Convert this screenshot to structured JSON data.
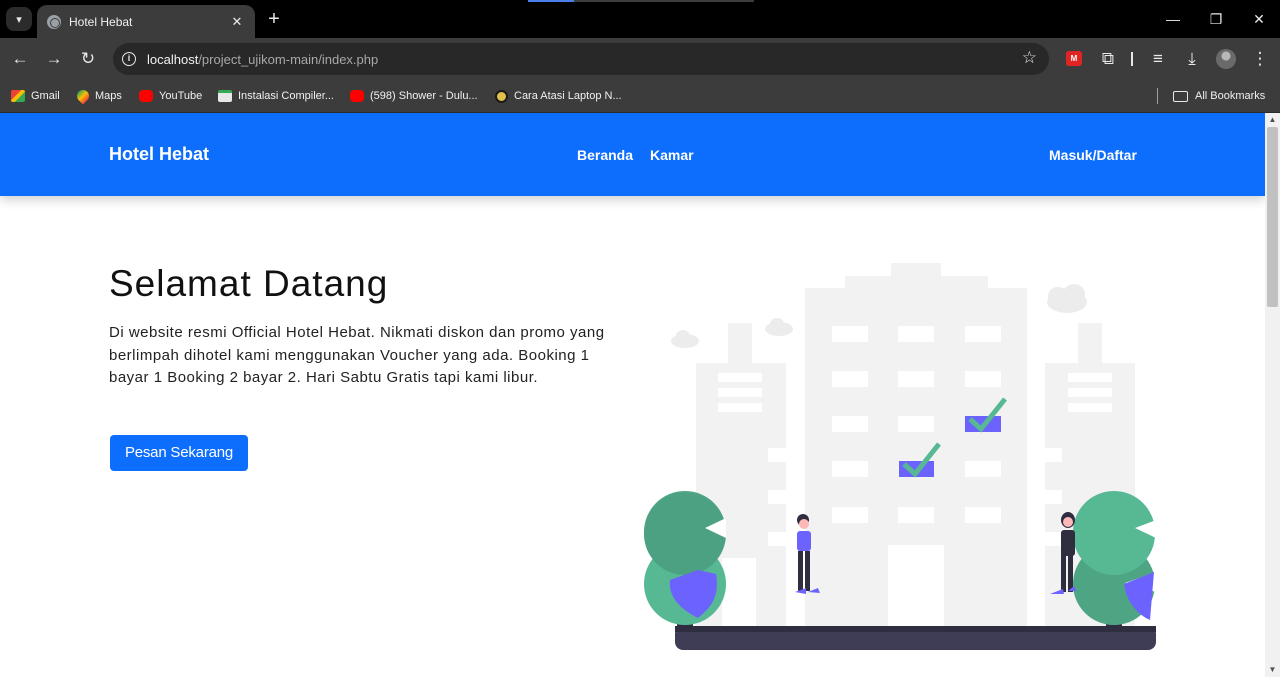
{
  "browser": {
    "tab_title": "Hotel Hebat",
    "tab_close": "✕",
    "new_tab": "+",
    "url_host": "localhost",
    "url_path": "/project_ujikom-main/index.php",
    "ext_label": "M",
    "bookmarks": [
      "Gmail",
      "Maps",
      "YouTube",
      "Instalasi Compiler...",
      "(598) Shower - Dulu...",
      "Cara Atasi Laptop N..."
    ],
    "all_bookmarks": "All Bookmarks"
  },
  "navbar": {
    "brand": "Hotel Hebat",
    "links": [
      "Beranda",
      "Kamar"
    ],
    "login": "Masuk/Daftar",
    "color": "#0d6efd"
  },
  "hero": {
    "title": "Selamat Datang",
    "text": "Di website resmi Official Hotel Hebat. Nikmati diskon dan promo yang berlimpah dihotel kami menggunakan Voucher yang ada. Booking 1 bayar 1 Booking 2 bayar 2. Hari Sabtu Gratis tapi kami libur.",
    "cta": "Pesan Sekarang"
  },
  "colors": {
    "accent": "#0d6efd",
    "tree": "#57b894",
    "check": "#6c63ff"
  }
}
